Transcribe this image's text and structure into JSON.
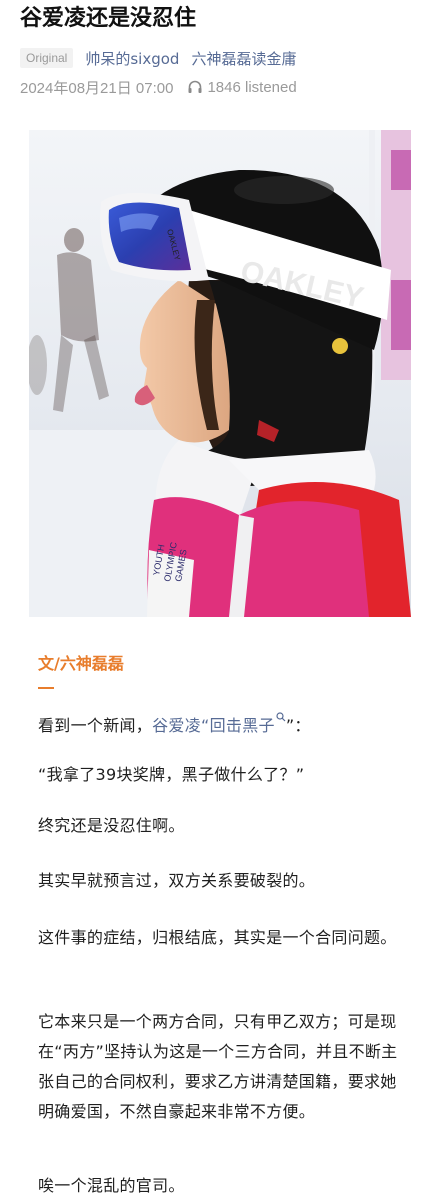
{
  "article": {
    "title": "谷爱凌还是没忍住",
    "badge": "Original",
    "author": "帅呆的sixgod",
    "account": "六神磊磊读金庸",
    "date": "2024年08月21日 07:00",
    "listens": "1846 listened"
  },
  "photo": {
    "description_icon": "athlete-photo",
    "goggle_brand": "OAKLEY",
    "helmet_brand": "OAKLEY",
    "bib_text_line1": "YOUTH",
    "bib_text_line2": "OLYMPIC",
    "bib_text_line3": "GAMES"
  },
  "body": {
    "byline": "文/六神磊磊",
    "p1_prefix": "看到一个新闻，",
    "p1_link": "谷爱凌“回击黑子",
    "p1_suffix": "”：",
    "p2": "“我拿了39块奖牌，黑子做什么了？”",
    "p3": "终究还是没忍住啊。",
    "p4": "其实早就预言过，双方关系要破裂的。",
    "p5": "这件事的症结，归根结底，其实是一个合同问题。",
    "p6": "它本来只是一个两方合同，只有甲乙双方；可是现在“丙方”坚持认为这是一个三方合同，并且不断主张自己的合同权利，要求乙方讲清楚国籍，要求她明确爱国，不然自豪起来非常不方便。",
    "p7": "唉一个混乱的官司。"
  },
  "colors": {
    "accent": "#e87d2c",
    "link": "#576b95",
    "meta": "#9a9a9a"
  }
}
